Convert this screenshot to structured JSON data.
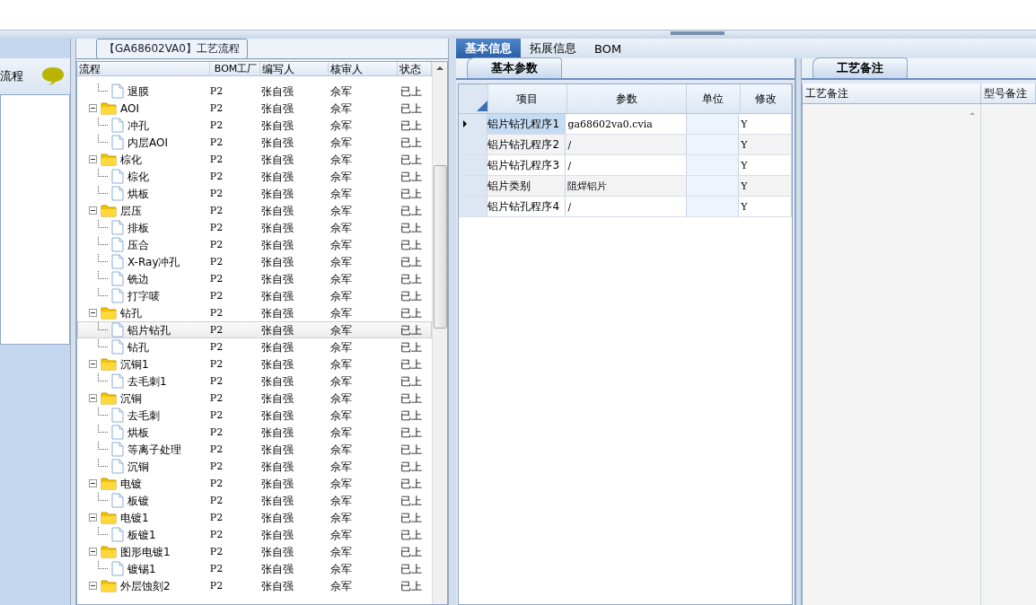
{
  "left_panel": {
    "title": "流程"
  },
  "process_panel": {
    "title": "【GA68602VA0】工艺流程",
    "columns": [
      "流程",
      "BOM工厂",
      "编写人",
      "核审人",
      "状态"
    ],
    "tree": [
      {
        "children": [
          {
            "kind": "file",
            "name": "退膜",
            "bom": "P2",
            "author": "张自强",
            "reviewer": "佘军",
            "status": "已上",
            "selected": false
          }
        ]
      },
      {
        "kind": "folder",
        "name": "AOI",
        "bom": "P2",
        "author": "张自强",
        "reviewer": "佘军",
        "status": "已上",
        "selected": false,
        "expanded": true,
        "children": [
          {
            "kind": "file",
            "name": "冲孔",
            "bom": "P2",
            "author": "张自强",
            "reviewer": "佘军",
            "status": "已上",
            "selected": false
          },
          {
            "kind": "file",
            "name": "内层AOI",
            "bom": "P2",
            "author": "张自强",
            "reviewer": "佘军",
            "status": "已上",
            "selected": false
          }
        ]
      },
      {
        "kind": "folder",
        "name": "棕化",
        "bom": "P2",
        "author": "张自强",
        "reviewer": "佘军",
        "status": "已上",
        "selected": false,
        "expanded": true,
        "children": [
          {
            "kind": "file",
            "name": "棕化",
            "bom": "P2",
            "author": "张自强",
            "reviewer": "佘军",
            "status": "已上",
            "selected": false
          },
          {
            "kind": "file",
            "name": "烘板",
            "bom": "P2",
            "author": "张自强",
            "reviewer": "佘军",
            "status": "已上",
            "selected": false
          }
        ]
      },
      {
        "kind": "folder",
        "name": "层压",
        "bom": "P2",
        "author": "张自强",
        "reviewer": "佘军",
        "status": "已上",
        "selected": false,
        "expanded": true,
        "children": [
          {
            "kind": "file",
            "name": "排板",
            "bom": "P2",
            "author": "张自强",
            "reviewer": "佘军",
            "status": "已上",
            "selected": false
          },
          {
            "kind": "file",
            "name": "压合",
            "bom": "P2",
            "author": "张自强",
            "reviewer": "佘军",
            "status": "已上",
            "selected": false
          },
          {
            "kind": "file",
            "name": "X-Ray冲孔",
            "bom": "P2",
            "author": "张自强",
            "reviewer": "佘军",
            "status": "已上",
            "selected": false
          },
          {
            "kind": "file",
            "name": "铣边",
            "bom": "P2",
            "author": "张自强",
            "reviewer": "佘军",
            "status": "已上",
            "selected": false
          },
          {
            "kind": "file",
            "name": "打字唛",
            "bom": "P2",
            "author": "张自强",
            "reviewer": "佘军",
            "status": "已上",
            "selected": false
          }
        ]
      },
      {
        "kind": "folder",
        "name": "钻孔",
        "bom": "P2",
        "author": "张自强",
        "reviewer": "佘军",
        "status": "已上",
        "selected": false,
        "expanded": true,
        "children": [
          {
            "kind": "file",
            "name": "铝片钻孔",
            "bom": "P2",
            "author": "张自强",
            "reviewer": "佘军",
            "status": "已上",
            "selected": true
          },
          {
            "kind": "file",
            "name": "钻孔",
            "bom": "P2",
            "author": "张自强",
            "reviewer": "佘军",
            "status": "已上",
            "selected": false
          }
        ]
      },
      {
        "kind": "folder",
        "name": "沉铜1",
        "bom": "P2",
        "author": "张自强",
        "reviewer": "佘军",
        "status": "已上",
        "selected": false,
        "expanded": true,
        "children": [
          {
            "kind": "file",
            "name": "去毛刺1",
            "bom": "P2",
            "author": "张自强",
            "reviewer": "佘军",
            "status": "已上",
            "selected": false
          }
        ]
      },
      {
        "kind": "folder",
        "name": "沉铜",
        "bom": "P2",
        "author": "张自强",
        "reviewer": "佘军",
        "status": "已上",
        "selected": false,
        "expanded": true,
        "children": [
          {
            "kind": "file",
            "name": "去毛刺",
            "bom": "P2",
            "author": "张自强",
            "reviewer": "佘军",
            "status": "已上",
            "selected": false
          },
          {
            "kind": "file",
            "name": "烘板",
            "bom": "P2",
            "author": "张自强",
            "reviewer": "佘军",
            "status": "已上",
            "selected": false
          },
          {
            "kind": "file",
            "name": "等离子处理",
            "bom": "P2",
            "author": "张自强",
            "reviewer": "佘军",
            "status": "已上",
            "selected": false
          },
          {
            "kind": "file",
            "name": "沉铜",
            "bom": "P2",
            "author": "张自强",
            "reviewer": "佘军",
            "status": "已上",
            "selected": false
          }
        ]
      },
      {
        "kind": "folder",
        "name": "电镀",
        "bom": "P2",
        "author": "张自强",
        "reviewer": "佘军",
        "status": "已上",
        "selected": false,
        "expanded": true,
        "children": [
          {
            "kind": "file",
            "name": "板镀",
            "bom": "P2",
            "author": "张自强",
            "reviewer": "佘军",
            "status": "已上",
            "selected": false
          }
        ]
      },
      {
        "kind": "folder",
        "name": "电镀1",
        "bom": "P2",
        "author": "张自强",
        "reviewer": "佘军",
        "status": "已上",
        "selected": false,
        "expanded": true,
        "children": [
          {
            "kind": "file",
            "name": "板镀1",
            "bom": "P2",
            "author": "张自强",
            "reviewer": "佘军",
            "status": "已上",
            "selected": false
          }
        ]
      },
      {
        "kind": "folder",
        "name": "图形电镀1",
        "bom": "P2",
        "author": "张自强",
        "reviewer": "佘军",
        "status": "已上",
        "selected": false,
        "expanded": true,
        "children": [
          {
            "kind": "file",
            "name": "镀锡1",
            "bom": "P2",
            "author": "张自强",
            "reviewer": "佘军",
            "status": "已上",
            "selected": false
          }
        ]
      },
      {
        "kind": "folder",
        "name": "外层蚀刻2",
        "bom": "P2",
        "author": "张自强",
        "reviewer": "佘军",
        "status": "已上",
        "selected": false,
        "expanded": true
      }
    ]
  },
  "tabs": [
    {
      "label": "基本信息",
      "selected": true
    },
    {
      "label": "拓展信息",
      "selected": false
    },
    {
      "label": "BOM",
      "selected": false
    }
  ],
  "params_panel": {
    "tab": "基本参数",
    "columns": [
      "项目",
      "参数",
      "单位",
      "修改"
    ],
    "rows": [
      {
        "item": "铝片钻孔程序1",
        "param": "ga68602va0.cvia",
        "modify": "Y",
        "selected": true
      },
      {
        "item": "铝片钻孔程序2",
        "param": "/",
        "modify": "Y",
        "selected": false
      },
      {
        "item": "铝片钻孔程序3",
        "param": "/",
        "modify": "Y",
        "selected": false
      },
      {
        "item": "铝片类别",
        "param": "阻焊铝片",
        "modify": "Y",
        "selected": false
      },
      {
        "item": "铝片钻孔程序4",
        "param": "/",
        "modify": "Y",
        "selected": false
      }
    ]
  },
  "notes_panel": {
    "tab": "工艺备注",
    "columns": [
      "工艺备注",
      "型号备注"
    ]
  }
}
